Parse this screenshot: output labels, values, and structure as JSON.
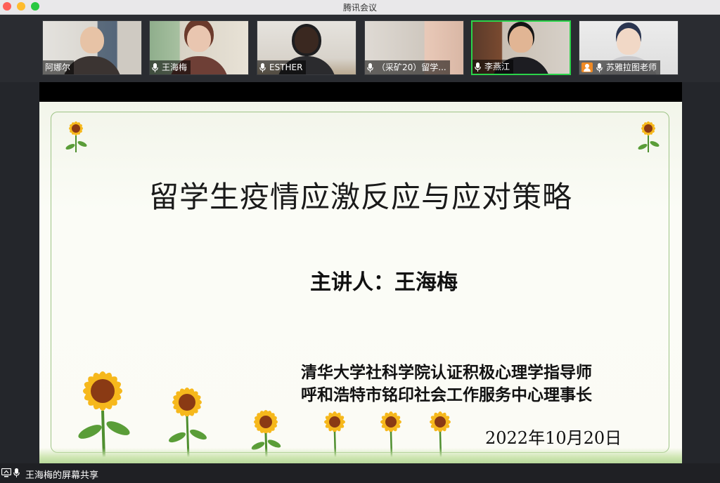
{
  "window": {
    "title": "腾讯会议"
  },
  "participants": [
    {
      "name": "阿娜尔",
      "mic": false,
      "host": false,
      "active": false
    },
    {
      "name": "王海梅",
      "mic": true,
      "host": false,
      "active": false
    },
    {
      "name": "ESTHER",
      "mic": true,
      "host": false,
      "active": false
    },
    {
      "name": "（采矿20）留学...",
      "mic": true,
      "host": false,
      "active": false
    },
    {
      "name": "李燕江",
      "mic": true,
      "host": false,
      "active": true
    },
    {
      "name": "苏雅拉图老师",
      "mic": true,
      "host": true,
      "active": false
    }
  ],
  "slide": {
    "title": "留学生疫情应激反应与应对策略",
    "speaker": "主讲人：王海梅",
    "credential_1": "清华大学社科学院认证积极心理学指导师",
    "credential_2": "呼和浩特市铭印社会工作服务中心理事长",
    "date": "2022年10月20日"
  },
  "status": {
    "share_label": "王海梅的屏幕共享"
  },
  "colors": {
    "active_border": "#2bd44a",
    "host_badge": "#f08a24"
  },
  "icons": [
    "microphone-icon",
    "host-icon",
    "screen-share-icon",
    "sunflower-icon"
  ]
}
